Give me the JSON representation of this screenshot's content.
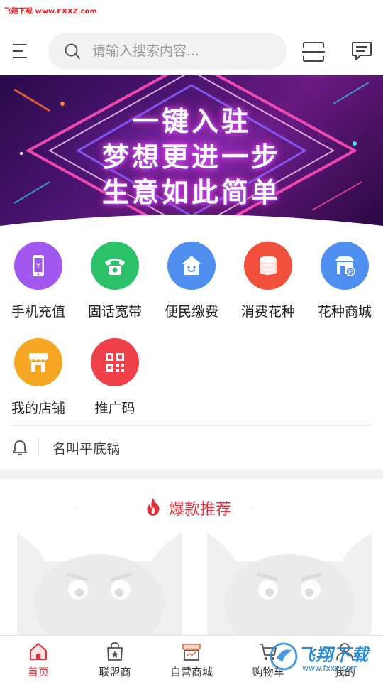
{
  "watermark_top": "飞翔下载 www.FXXZ.com",
  "search": {
    "placeholder": "请输入搜索内容..."
  },
  "banner": {
    "lines": [
      "一键入驻",
      "梦想更进一步",
      "生意如此简单"
    ]
  },
  "grid": [
    {
      "label": "手机充值",
      "icon": "phone-yuan-icon",
      "color": "#a257f0"
    },
    {
      "label": "固话宽带",
      "icon": "telephone-icon",
      "color": "#2bc26a"
    },
    {
      "label": "便民缴费",
      "icon": "house-smile-icon",
      "color": "#4f8ff0"
    },
    {
      "label": "消费花种",
      "icon": "coin-stack-icon",
      "color": "#f0503c"
    },
    {
      "label": "花种商城",
      "icon": "store-points-icon",
      "color": "#4f8ff0"
    },
    {
      "label": "我的店铺",
      "icon": "shop-awning-icon",
      "color": "#f5a623"
    },
    {
      "label": "推广码",
      "icon": "qrcode-icon",
      "color": "#f0404a"
    }
  ],
  "notice": {
    "text": "名叫平底锅"
  },
  "hot": {
    "title": "爆款推荐",
    "accent": "#e0313a"
  },
  "tabbar": [
    {
      "label": "首页",
      "icon": "home-icon",
      "active": true
    },
    {
      "label": "联盟商",
      "icon": "shopping-bag-star-icon",
      "active": false
    },
    {
      "label": "自营商城",
      "icon": "store-icon",
      "active": false
    },
    {
      "label": "购物车",
      "icon": "cart-icon",
      "active": false
    },
    {
      "label": "我的",
      "icon": "user-icon",
      "active": false
    }
  ],
  "watermark_br": {
    "brand": "飞翔下载",
    "url": "www.fxxz.com"
  }
}
